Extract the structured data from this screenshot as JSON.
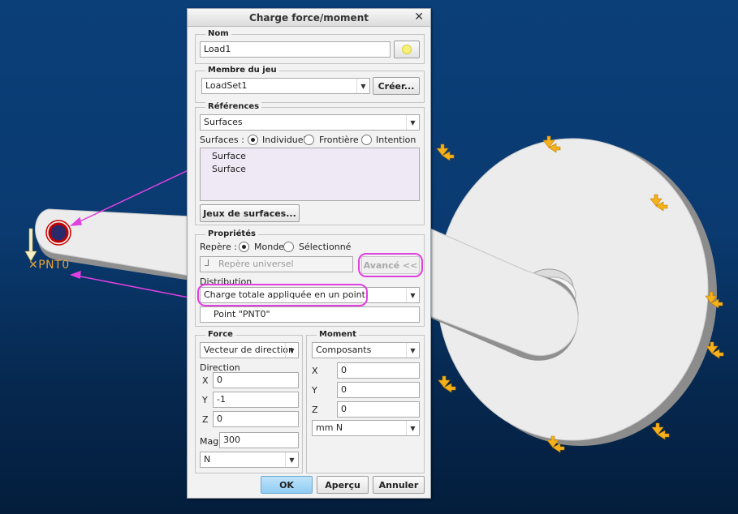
{
  "scene": {
    "point_label": "PNT0"
  },
  "dialog": {
    "title": "Charge force/moment",
    "name_group": {
      "legend": "Nom",
      "value": "Load1"
    },
    "member_group": {
      "legend": "Membre du jeu",
      "selected": "LoadSet1",
      "create_label": "Créer..."
    },
    "references_group": {
      "legend": "Références",
      "selected": "Surfaces",
      "surfaces_label": "Surfaces :",
      "options": [
        "Individuel",
        "Frontière",
        "Intention"
      ],
      "items": [
        "Surface",
        "Surface"
      ],
      "sets_label": "Jeux de surfaces..."
    },
    "properties_group": {
      "legend": "Propriétés",
      "repere_label": "Repère :",
      "repere_options": [
        "Monde",
        "Sélectionné"
      ],
      "csys_placeholder": "Repère universel",
      "advanced_label": "Avancé <<",
      "distribution_label": "Distribution",
      "distribution_selected": "Charge totale appliquée en un point",
      "point_value": "Point \"PNT0\""
    },
    "force_group": {
      "legend": "Force",
      "mode": "Vecteur de direction",
      "direction_label": "Direction",
      "x_label": "X",
      "x": "0",
      "y_label": "Y",
      "y": "-1",
      "z_label": "Z",
      "z": "0",
      "mag_label": "Mag",
      "mag": "300",
      "unit": "N"
    },
    "moment_group": {
      "legend": "Moment",
      "mode": "Composants",
      "x_label": "X",
      "x": "0",
      "y_label": "Y",
      "y": "0",
      "z_label": "Z",
      "z": "0",
      "unit": "mm N"
    },
    "buttons": {
      "ok": "OK",
      "preview": "Aperçu",
      "cancel": "Annuler"
    }
  },
  "colors": {
    "background": "#0a3a70",
    "highlight": "#e040e0",
    "constraint": "#f5b01a"
  }
}
